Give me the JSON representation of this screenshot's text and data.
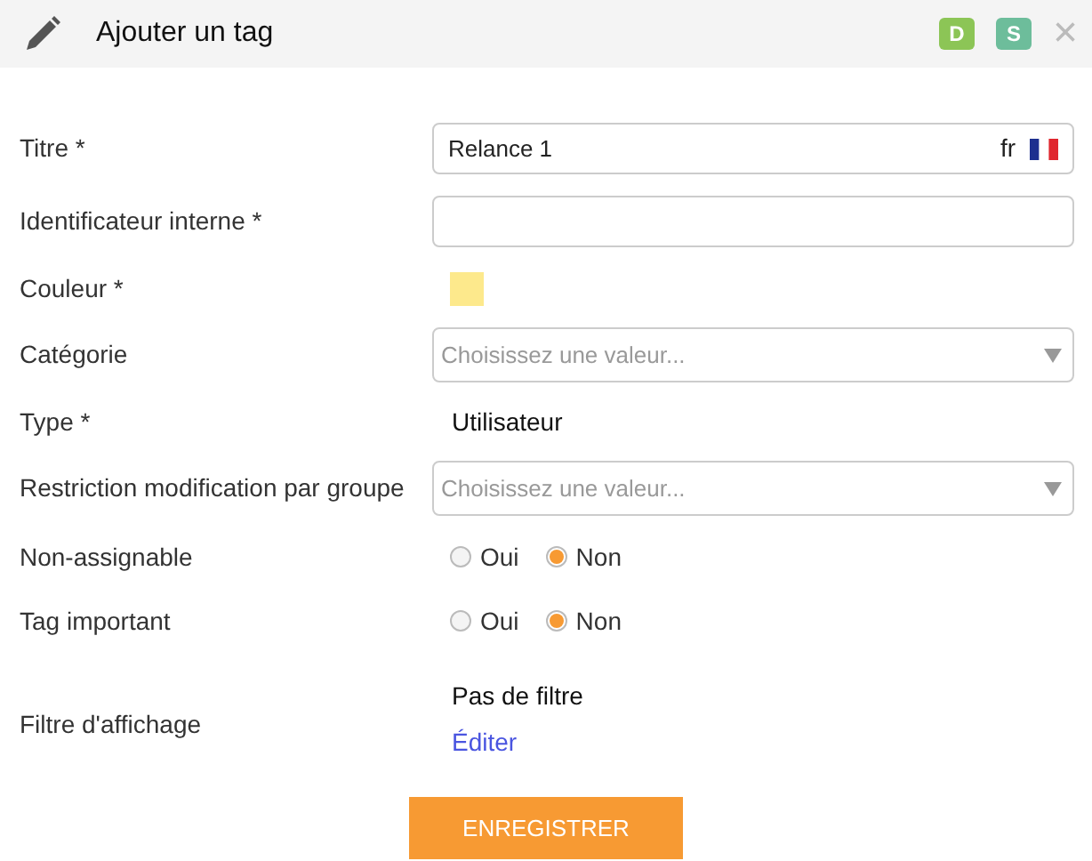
{
  "window": {
    "title": "Ajouter un tag",
    "badges": [
      {
        "label": "D",
        "color": "#8cc556"
      },
      {
        "label": "S",
        "color": "#6dbd9b"
      }
    ],
    "close": "×"
  },
  "fields": [
    {
      "kind": "text",
      "label": "Titre *",
      "value": "Relance 1",
      "lang": "fr"
    },
    {
      "kind": "text",
      "label": "Identificateur interne *"
    },
    {
      "kind": "color",
      "label": "Couleur *",
      "color": "#fde98c"
    },
    {
      "kind": "select",
      "label": "Catégorie",
      "placeholder": "Choisissez une valeur..."
    },
    {
      "kind": "static",
      "label": "Type *",
      "value": "Utilisateur"
    },
    {
      "kind": "select",
      "label": "Restriction modification par groupe",
      "placeholder": "Choisissez une valeur..."
    },
    {
      "kind": "radio",
      "label": "Non-assignable",
      "options": [
        {
          "label": "Oui",
          "selected": false
        },
        {
          "label": "Non",
          "selected": true
        }
      ]
    },
    {
      "kind": "radio",
      "label": "Tag important",
      "options": [
        {
          "label": "Oui",
          "selected": false
        },
        {
          "label": "Non",
          "selected": true
        }
      ]
    },
    {
      "kind": "filter",
      "label": "Filtre d'affichage",
      "value": "Pas de filtre",
      "link": "Éditer"
    }
  ],
  "submit": "ENREGISTRER"
}
